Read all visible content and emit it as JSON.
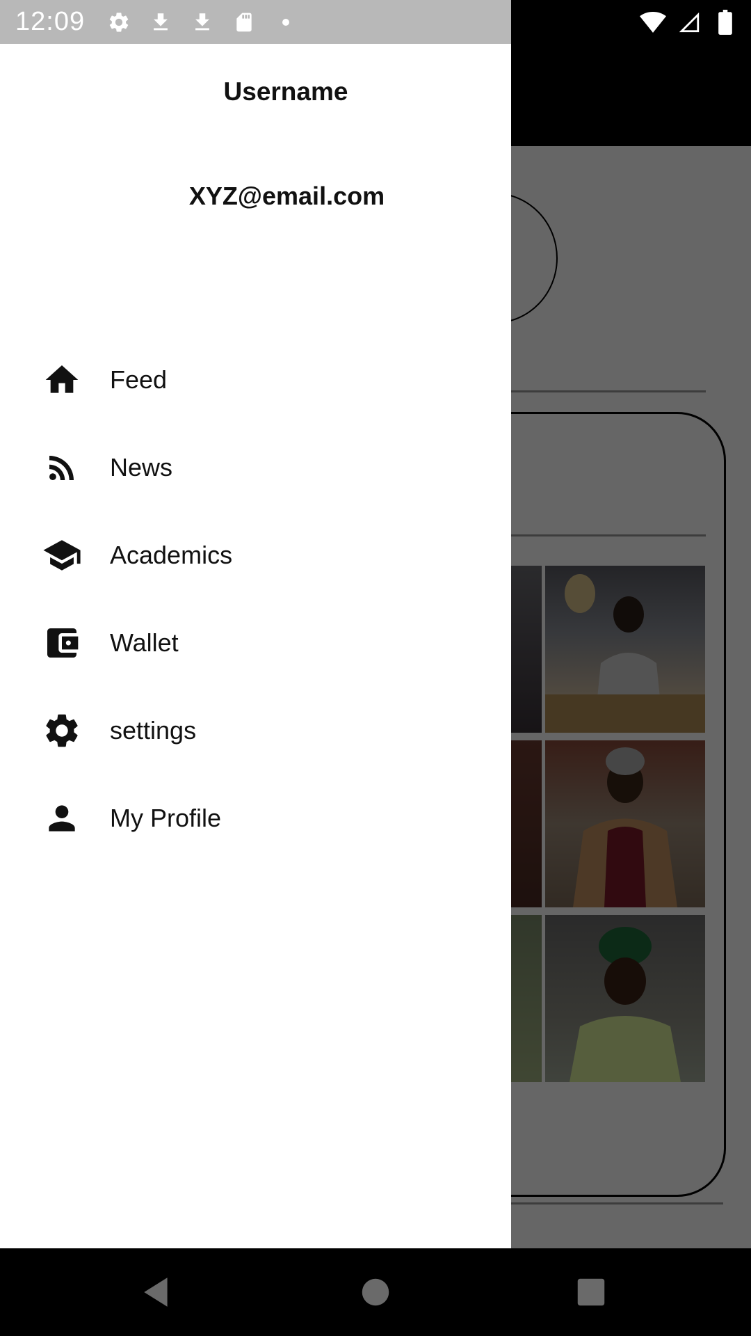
{
  "status_bar": {
    "time": "12:09",
    "left_icons": [
      "gear-icon",
      "download-icon",
      "download-icon",
      "sd-card-icon",
      "dot-icon"
    ],
    "right_icons": [
      "wifi-icon",
      "signal-icon",
      "battery-icon"
    ]
  },
  "drawer": {
    "username": "Username",
    "email": "XYZ@email.com",
    "items": [
      {
        "label": "Feed",
        "icon": "home-icon"
      },
      {
        "label": "News",
        "icon": "rss-icon"
      },
      {
        "label": "Academics",
        "icon": "school-icon"
      },
      {
        "label": "Wallet",
        "icon": "wallet-icon"
      },
      {
        "label": "settings",
        "icon": "gear-icon"
      },
      {
        "label": "My Profile",
        "icon": "person-icon"
      }
    ]
  },
  "nav_bar": {
    "buttons": [
      "back-icon",
      "home-circle-icon",
      "recents-icon"
    ]
  },
  "colors": {
    "drawer_bg": "#ffffff",
    "scrim": "#000000",
    "status_bar_bg": "#b8b8b8",
    "nav_bar_bg": "#000000"
  }
}
